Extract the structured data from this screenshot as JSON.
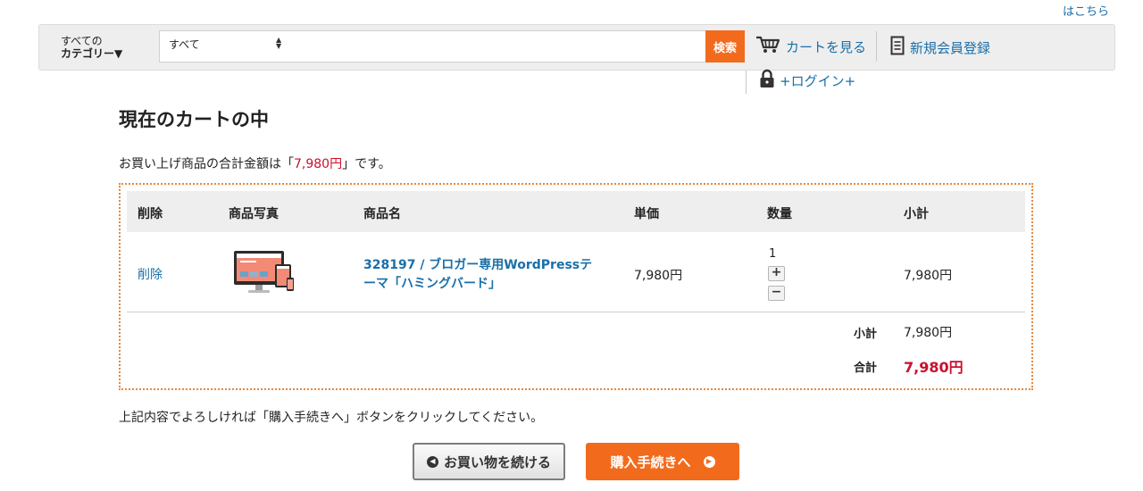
{
  "header": {
    "top_link": "はこちら",
    "category_line1": "すべての",
    "category_line2": "カテゴリー▼",
    "select_value": "すべて",
    "search_button": "検索",
    "cart_link": "カートを見る",
    "register_link": "新規会員登録",
    "login_link": "+ログイン+"
  },
  "cart": {
    "title": "現在のカートの中",
    "total_prefix": "お買い上げ商品の合計金額は「",
    "total_amount": "7,980円",
    "total_suffix": "」です。",
    "columns": {
      "delete": "削除",
      "photo": "商品写真",
      "name": "商品名",
      "unit_price": "単価",
      "quantity": "数量",
      "subtotal": "小計"
    },
    "items": [
      {
        "delete_label": "削除",
        "name_line1": "328197 / ブロガー専用WordPressテ",
        "name_line2": "ーマ「ハミングバード」",
        "unit_price": "7,980円",
        "quantity": "1",
        "subtotal": "7,980円"
      }
    ],
    "summary": {
      "subtotal_label": "小計",
      "subtotal_value": "7,980円",
      "total_label": "合計",
      "total_value": "7,980円"
    },
    "instruction": "上記内容でよろしければ「購入手続きへ」ボタンをクリックしてください。",
    "continue_button": "お買い物を続ける",
    "checkout_button": "購入手続きへ"
  },
  "colors": {
    "accent_orange": "#f26b1d",
    "link_blue": "#1a6fa8",
    "price_red": "#c8102e"
  },
  "icons": [
    "cart-icon",
    "document-icon",
    "lock-icon",
    "chevron-left-circle-icon",
    "chevron-right-circle-icon",
    "plus-icon",
    "minus-icon"
  ]
}
